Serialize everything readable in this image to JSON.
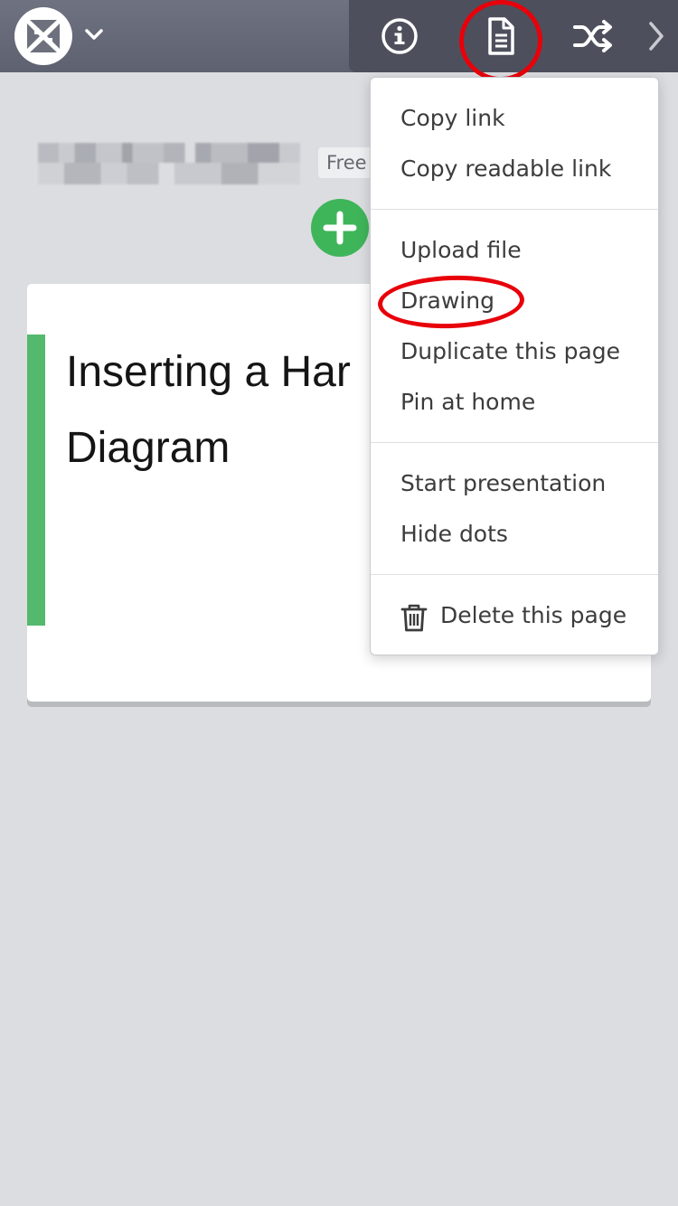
{
  "header": {
    "logo_icon": "app-logo-icon",
    "workspace_toggle_icon": "chevron-down-icon",
    "tools": [
      {
        "name": "info-icon"
      },
      {
        "name": "page-document-icon"
      },
      {
        "name": "shuffle-icon"
      },
      {
        "name": "chevron-right-icon"
      }
    ]
  },
  "page": {
    "title_obscured": true,
    "plan_badge": "Free",
    "add_button_icon": "plus-icon"
  },
  "card": {
    "title": "Inserting a Har\nDiagram",
    "accent_color": "#55b96d"
  },
  "menu": {
    "copy_link": "Copy link",
    "copy_readable_link": "Copy readable link",
    "upload_file": "Upload file",
    "drawing": "Drawing",
    "duplicate_page": "Duplicate this page",
    "pin_home": "Pin at home",
    "start_presentation": "Start presentation",
    "hide_dots": "Hide dots",
    "delete_page": "Delete this page",
    "delete_icon": "trash-icon"
  },
  "annotations": {
    "highlight_color": "#e8000a"
  }
}
